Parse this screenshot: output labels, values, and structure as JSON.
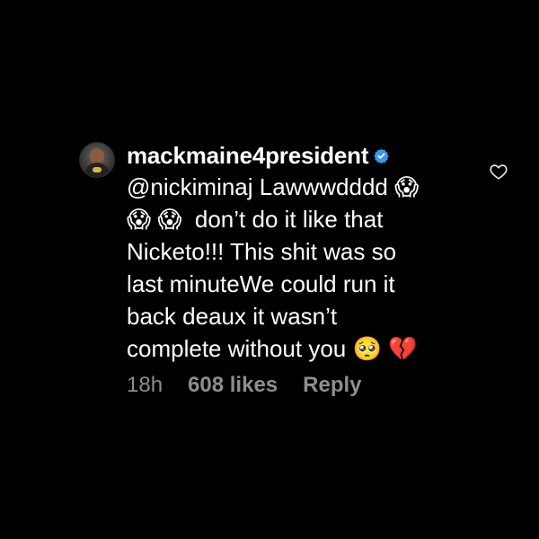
{
  "comment": {
    "username": "mackmaine4president",
    "mention": "@nickiminaj",
    "lines": [
      "Lawwwdddd 😱",
      "😱 😱  don’t do it like that",
      "Nicketo!!! This shit was so",
      "last minuteWe could run it",
      "back deaux it wasn’t",
      "complete without you 🥺 💔"
    ],
    "time": "18h",
    "likes": "608 likes",
    "reply_label": "Reply"
  },
  "icons": {
    "verified": "verified-badge-icon",
    "like": "heart-outline-icon"
  },
  "colors": {
    "background": "#000000",
    "text": "#ffffff",
    "meta": "#8e8e8e",
    "verified": "#3897f0"
  }
}
